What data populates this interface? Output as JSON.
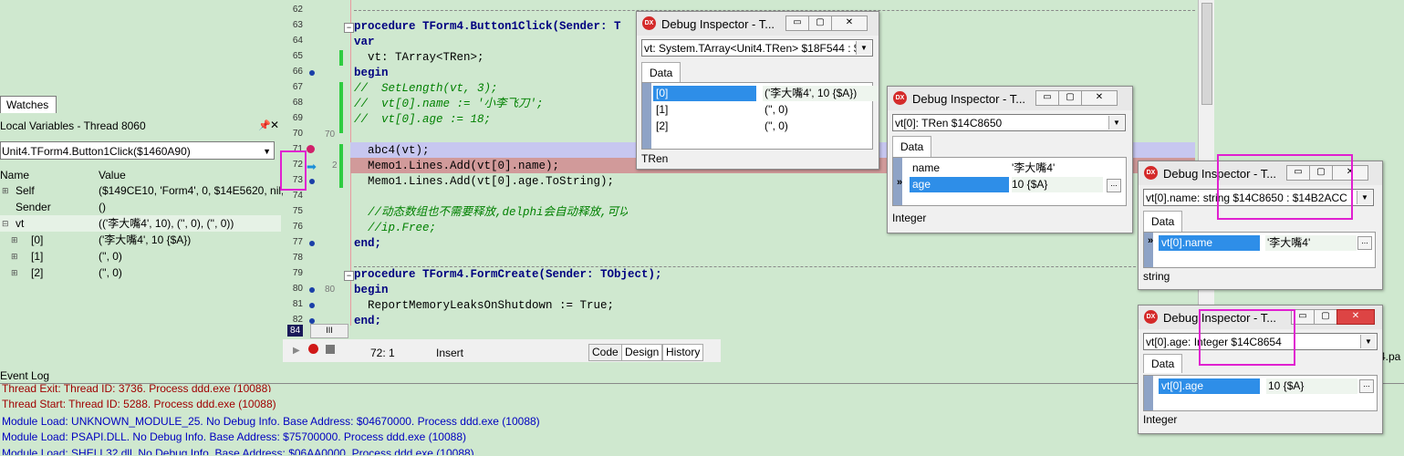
{
  "left": {
    "watches_tab": "Watches",
    "local_vars_title": "Local Variables - Thread 8060",
    "frame": "Unit4.TForm4.Button1Click($1460A90)",
    "col_name": "Name",
    "col_value": "Value",
    "rows": [
      {
        "name": "Self",
        "value": "($149CE10, 'Form4', 0, $14E5620, nil,..."
      },
      {
        "name": "Sender",
        "value": "()"
      },
      {
        "name": "vt",
        "value": "(('李大嘴4', 10), ('', 0), ('', 0))"
      },
      {
        "name": "[0]",
        "value": "('李大嘴4', 10 {$A})"
      },
      {
        "name": "[1]",
        "value": "('', 0)"
      },
      {
        "name": "[2]",
        "value": "('', 0)"
      }
    ]
  },
  "editor": {
    "lines": [
      {
        "num": "62",
        "text": ""
      },
      {
        "num": "63",
        "text": "procedure TForm4.Button1Click(Sender: T"
      },
      {
        "num": "64",
        "text": "var"
      },
      {
        "num": "65",
        "text": "  vt: TArray<TRen>;"
      },
      {
        "num": "66",
        "text": "begin"
      },
      {
        "num": "67",
        "text": "//  SetLength(vt, 3);"
      },
      {
        "num": "68",
        "text": "//  vt[0].name := '小李飞刀';"
      },
      {
        "num": "69",
        "text": "//  vt[0].age := 18;"
      },
      {
        "num": "70",
        "text": ""
      },
      {
        "num": "71",
        "text": "  abc4(vt);"
      },
      {
        "num": "72",
        "text": "  Memo1.Lines.Add(vt[0].name);"
      },
      {
        "num": "73",
        "text": "  Memo1.Lines.Add(vt[0].age.ToString);"
      },
      {
        "num": "74",
        "text": ""
      },
      {
        "num": "75",
        "text": "  //动态数组也不需要释放,delphi会自动释放,可以看下面的汇编截图,与接口的引"
      },
      {
        "num": "76",
        "text": "  //ip.Free;"
      },
      {
        "num": "77",
        "text": "end;"
      },
      {
        "num": "78",
        "text": ""
      },
      {
        "num": "79",
        "text": "procedure TForm4.FormCreate(Sender: TObject);"
      },
      {
        "num": "80",
        "text": "begin"
      },
      {
        "num": "81",
        "text": "  ReportMemoryLeaksOnShutdown := True;"
      },
      {
        "num": "82",
        "text": "end;"
      }
    ],
    "gutter_70": "70",
    "gutter_72": "2",
    "gutter_80": "80",
    "line_84": "84",
    "hscroll": "III"
  },
  "status": {
    "position": "72:  1",
    "mode": "Insert",
    "tab_code": "Code",
    "tab_design": "Design",
    "tab_history": "History",
    "file_fragment": "4.pa"
  },
  "eventlog": {
    "title": "Event Log",
    "lines": [
      {
        "text": "Thread Exit: Thread ID: 3736. Process ddd.exe (10088)",
        "color": "#a00000"
      },
      {
        "text": "Thread Start: Thread ID: 5288. Process ddd.exe (10088)",
        "color": "#a00000"
      },
      {
        "text": "Module Load: UNKNOWN_MODULE_25. No Debug Info. Base Address: $04670000. Process ddd.exe (10088)",
        "color": "#0000c0"
      },
      {
        "text": "Module Load: PSAPI.DLL. No Debug Info. Base Address: $75700000. Process ddd.exe (10088)",
        "color": "#0000c0"
      },
      {
        "text": "Module Load: SHELL32.dll. No Debug Info. Base Address: $06AA0000. Process ddd.exe (10088)",
        "color": "#0000c0"
      }
    ]
  },
  "inspectors": [
    {
      "title": "Debug Inspector - T...",
      "combo": "vt: System.TArray<Unit4.TRen> $18F544 : $1",
      "tab": "Data",
      "rows": [
        {
          "k": "[0]",
          "v": "('李大嘴4', 10 {$A})"
        },
        {
          "k": "[1]",
          "v": "('', 0)"
        },
        {
          "k": "[2]",
          "v": "('', 0)"
        }
      ],
      "status": "TRen"
    },
    {
      "title": "Debug Inspector - T...",
      "combo": "vt[0]: TRen $14C8650",
      "tab": "Data",
      "rows": [
        {
          "k": "name",
          "v": "'李大嘴4'"
        },
        {
          "k": "age",
          "v": "10 {$A}"
        }
      ],
      "status": "Integer"
    },
    {
      "title": "Debug Inspector - T...",
      "combo": "vt[0].name: string $14C8650 : $14B2ACC",
      "tab": "Data",
      "rows": [
        {
          "k": "vt[0].name",
          "v": "'李大嘴4'"
        }
      ],
      "status": "string"
    },
    {
      "title": "Debug Inspector - T...",
      "combo": "vt[0].age: Integer $14C8654",
      "tab": "Data",
      "rows": [
        {
          "k": "vt[0].age",
          "v": "10 {$A}"
        }
      ],
      "status": "Integer"
    }
  ],
  "icons": {
    "dx": "DX",
    "min": "▭",
    "max": "▢",
    "close": "✕",
    "dropdown": "▼",
    "ellipsis": "..."
  }
}
